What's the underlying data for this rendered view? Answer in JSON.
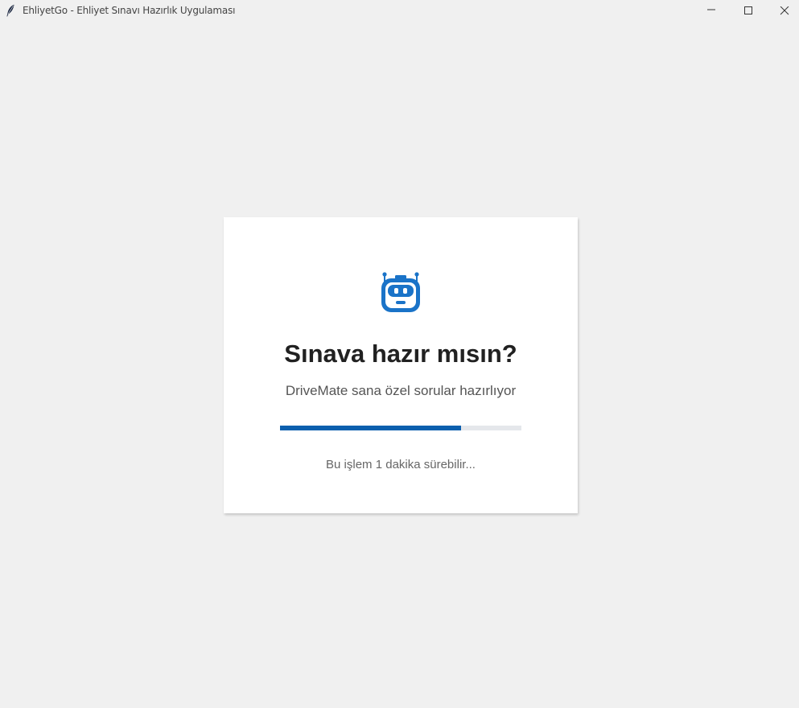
{
  "window": {
    "title": "EhliyetGo - Ehliyet Sınavı Hazırlık Uygulaması",
    "icon": "feather-icon",
    "controls": [
      "minimize-icon",
      "maximize-icon",
      "close-icon"
    ]
  },
  "card": {
    "icon": "robot-icon",
    "title": "Sınava hazır mısın?",
    "subtitle": "DriveMate sana özel sorular hazırlıyor",
    "progress_percent": 75,
    "note": "Bu işlem 1 dakika sürebilir..."
  },
  "colors": {
    "accent": "#0b5fae",
    "icon": "#1a73c8",
    "track": "#e5e7eb",
    "background": "#f0f0f0",
    "card": "#ffffff"
  }
}
